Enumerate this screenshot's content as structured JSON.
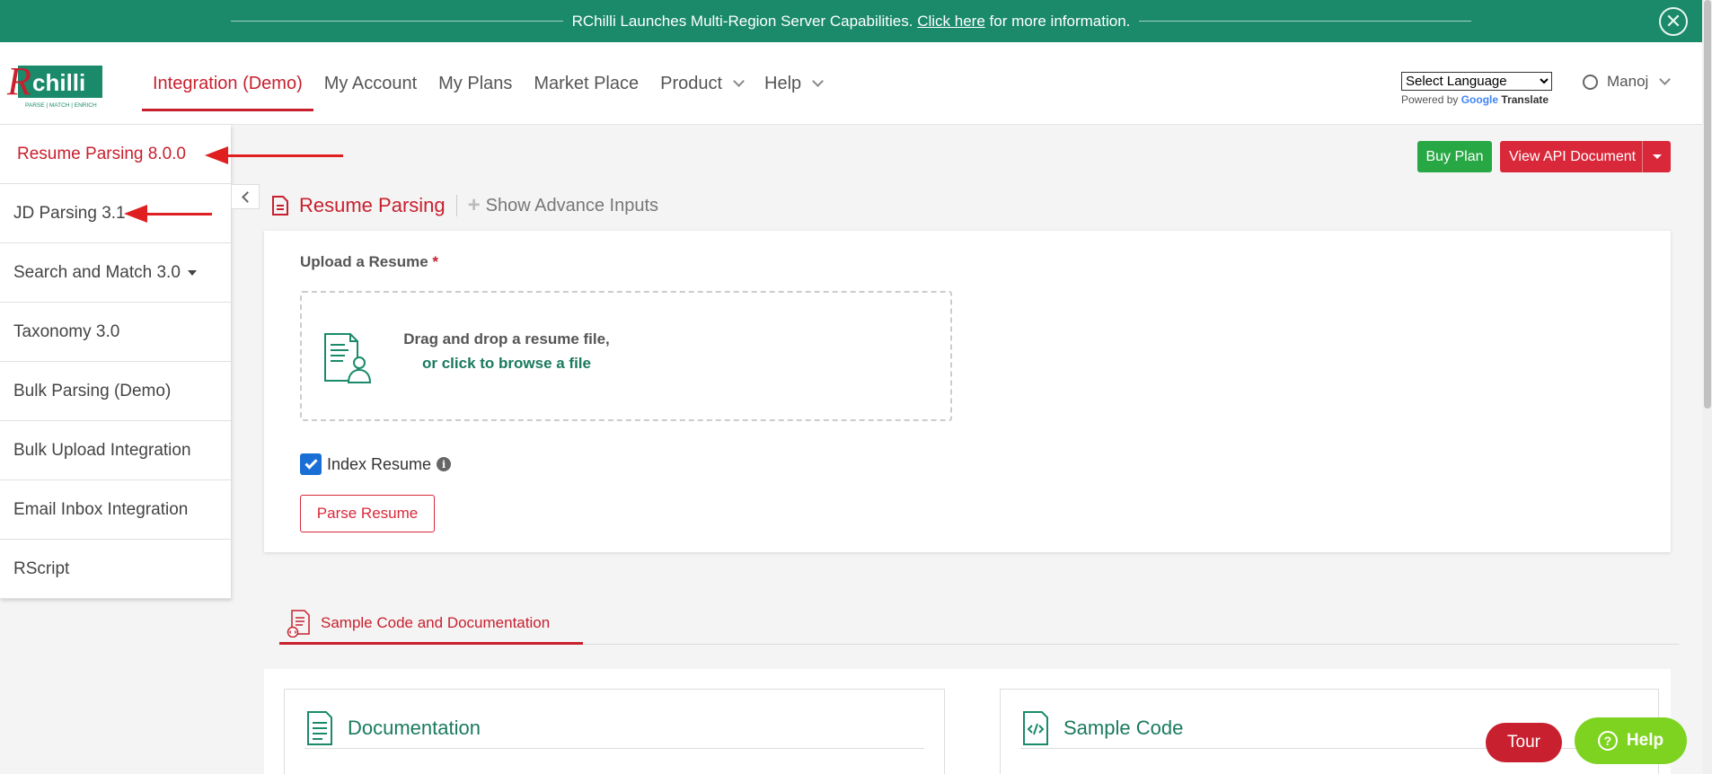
{
  "banner": {
    "text_before": "RChilli Launches Multi-Region Server Capabilities.",
    "link": "Click here",
    "text_after": "for more information.",
    "close_glyph": "✕"
  },
  "logo": {
    "wordmark": "Rchilli",
    "tagline": "PARSE | MATCH | ENRICH"
  },
  "nav": {
    "items": [
      {
        "label": "Integration (Demo)"
      },
      {
        "label": "My Account"
      },
      {
        "label": "My Plans"
      },
      {
        "label": "Market Place"
      },
      {
        "label": "Product"
      },
      {
        "label": "Help"
      }
    ]
  },
  "language": {
    "selected": "Select Language",
    "powered_by": "Powered by",
    "google": "Google",
    "translate": "Translate"
  },
  "user": {
    "name": "Manoj"
  },
  "sidebar": {
    "items": [
      {
        "label": "Resume Parsing 8.0.0"
      },
      {
        "label": "JD Parsing 3.1"
      },
      {
        "label": "Search and Match 3.0"
      },
      {
        "label": "Taxonomy 3.0"
      },
      {
        "label": "Bulk Parsing (Demo)"
      },
      {
        "label": "Bulk Upload Integration"
      },
      {
        "label": "Email Inbox Integration"
      },
      {
        "label": "RScript"
      }
    ]
  },
  "actions": {
    "buy_plan": "Buy Plan",
    "view_api": "View API Document"
  },
  "page": {
    "title": "Resume Parsing",
    "advance": "Show Advance Inputs"
  },
  "upload": {
    "label": "Upload a Resume",
    "required_mark": "*",
    "drop_line1": "Drag and drop a resume file,",
    "drop_line2": "or click to browse a file",
    "index_label": "Index Resume",
    "index_checked": true,
    "parse_button": "Parse Resume"
  },
  "tabs": {
    "sample": "Sample Code and Documentation"
  },
  "cards": {
    "documentation": "Documentation",
    "sample_code": "Sample Code"
  },
  "floating": {
    "tour": "Tour",
    "help": "Help"
  },
  "colors": {
    "brand_green": "#1a8a6a",
    "accent_red": "#c8202e",
    "buy_green": "#28a745",
    "help_green": "#7ed320"
  }
}
